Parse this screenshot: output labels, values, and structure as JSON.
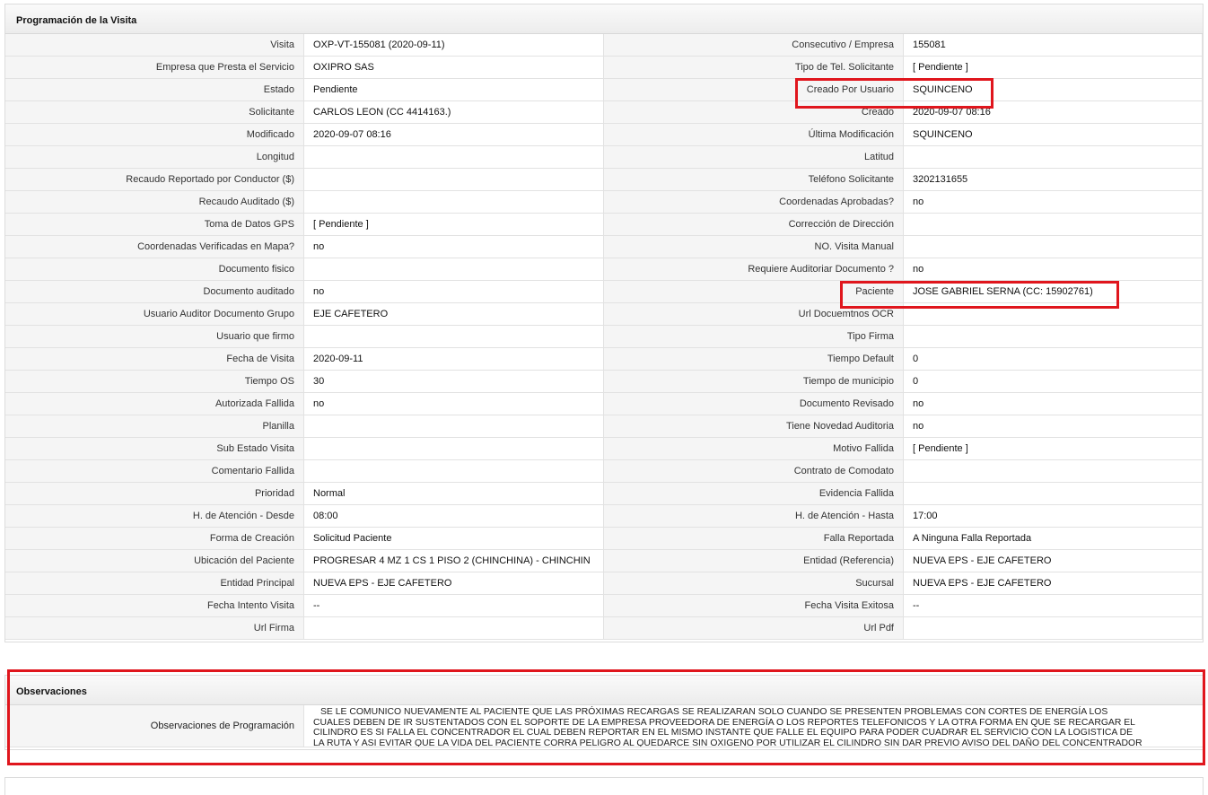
{
  "section": {
    "title": "Programación de la Visita"
  },
  "rows": [
    {
      "l1": "Visita",
      "v1": "OXP-VT-155081 (2020-09-11)",
      "l2": "Consecutivo / Empresa",
      "v2": "155081"
    },
    {
      "l1": "Empresa que Presta el Servicio",
      "v1": "OXIPRO SAS",
      "l2": "Tipo de Tel. Solicitante",
      "v2": "[ Pendiente ]"
    },
    {
      "l1": "Estado",
      "v1": "Pendiente",
      "l2": "Creado Por Usuario",
      "v2": "SQUINCENO"
    },
    {
      "l1": "Solicitante",
      "v1": "CARLOS LEON (CC 4414163.)",
      "l2": "Creado",
      "v2": "2020-09-07 08:16"
    },
    {
      "l1": "Modificado",
      "v1": "2020-09-07 08:16",
      "l2": "Última Modificación",
      "v2": " SQUINCENO"
    },
    {
      "l1": "Longitud",
      "v1": "",
      "l2": "Latitud",
      "v2": ""
    },
    {
      "l1": "Recaudo Reportado por Conductor ($)",
      "v1": "",
      "l2": "Teléfono Solicitante",
      "v2": "3202131655"
    },
    {
      "l1": "Recaudo Auditado ($)",
      "v1": "",
      "l2": "Coordenadas Aprobadas?",
      "v2": " no"
    },
    {
      "l1": "Toma de Datos GPS",
      "v1": "[ Pendiente ]",
      "l2": "Corrección de Dirección",
      "v2": ""
    },
    {
      "l1": "Coordenadas Verificadas en Mapa?",
      "v1": " no",
      "l2": "NO. Visita Manual",
      "v2": ""
    },
    {
      "l1": "Documento fisico",
      "v1": "",
      "l2": "Requiere Auditoriar Documento ?",
      "v2": " no"
    },
    {
      "l1": "Documento auditado",
      "v1": " no",
      "l2": "Paciente",
      "v2": "JOSE GABRIEL SERNA (CC: 15902761)"
    },
    {
      "l1": "Usuario Auditor Documento Grupo",
      "v1": "EJE CAFETERO",
      "l2": "Url Docuemtnos OCR",
      "v2": ""
    },
    {
      "l1": "Usuario que firmo",
      "v1": "",
      "l2": "Tipo Firma",
      "v2": ""
    },
    {
      "l1": "Fecha de Visita",
      "v1": " 2020-09-11",
      "l2": "Tiempo Default",
      "v2": "0"
    },
    {
      "l1": "Tiempo OS",
      "v1": "30",
      "l2": "Tiempo de municipio",
      "v2": "0"
    },
    {
      "l1": "Autorizada Fallida",
      "v1": " no",
      "l2": "Documento Revisado",
      "v2": " no"
    },
    {
      "l1": "Planilla",
      "v1": "",
      "l2": "Tiene Novedad Auditoria",
      "v2": " no"
    },
    {
      "l1": "Sub Estado Visita",
      "v1": "",
      "l2": "Motivo Fallida",
      "v2": "[ Pendiente ]"
    },
    {
      "l1": "Comentario Fallida",
      "v1": "",
      "l2": "Contrato de Comodato",
      "v2": ""
    },
    {
      "l1": "Prioridad",
      "v1": "Normal",
      "l2": "Evidencia Fallida",
      "v2": ""
    },
    {
      "l1": "H. de Atención - Desde",
      "v1": "08:00",
      "l2": "H. de Atención - Hasta",
      "v2": "17:00"
    },
    {
      "l1": "Forma de Creación",
      "v1": "Solicitud Paciente",
      "l2": "Falla Reportada",
      "v2": "A Ninguna Falla Reportada"
    },
    {
      "l1": "Ubicación del Paciente",
      "v1": "PROGRESAR 4 MZ 1 CS 1 PISO 2 (CHINCHINA) - CHINCHIN",
      "l2": "Entidad (Referencia)",
      "v2": "NUEVA EPS - EJE CAFETERO"
    },
    {
      "l1": "Entidad Principal",
      "v1": "NUEVA EPS - EJE CAFETERO",
      "l2": "Sucursal",
      "v2": "NUEVA EPS - EJE CAFETERO"
    },
    {
      "l1": "Fecha Intento Visita",
      "v1": " --",
      "l2": "Fecha Visita Exitosa",
      "v2": " --"
    },
    {
      "l1": "Url Firma",
      "v1": "",
      "l2": "Url Pdf",
      "v2": ""
    }
  ],
  "observaciones": {
    "title": "Observaciones",
    "label": "Observaciones de Programación",
    "lines": [
      "SE LE COMUNICO NUEVAMENTE AL PACIENTE QUE LAS PRÓXIMAS RECARGAS SE REALIZARAN SOLO CUANDO SE PRESENTEN PROBLEMAS CON CORTES DE ENERGÍA LOS",
      "CUALES DEBEN DE IR SUSTENTADOS CON EL SOPORTE DE LA EMPRESA PROVEEDORA DE ENERGÍA O LOS REPORTES TELEFONICOS Y LA OTRA FORMA EN QUE SE RECARGAR EL",
      "CILINDRO ES SI FALLA EL CONCENTRADOR EL CUAL DEBEN REPORTAR EN EL MISMO INSTANTE QUE FALLE EL EQUIPO PARA PODER CUADRAR EL SERVICIO CON LA LOGISTICA DE",
      "LA RUTA Y ASI EVITAR QUE LA VIDA DEL PACIENTE CORRA PELIGRO AL QUEDARCE SIN OXIGENO POR UTILIZAR EL CILINDRO SIN DAR PREVIO AVISO DEL DAÑO DEL CONCENTRADOR"
    ]
  },
  "colors": {
    "highlight": "#e0161d",
    "label_bg": "#f5f5f5",
    "border": "#e2e2e2"
  }
}
